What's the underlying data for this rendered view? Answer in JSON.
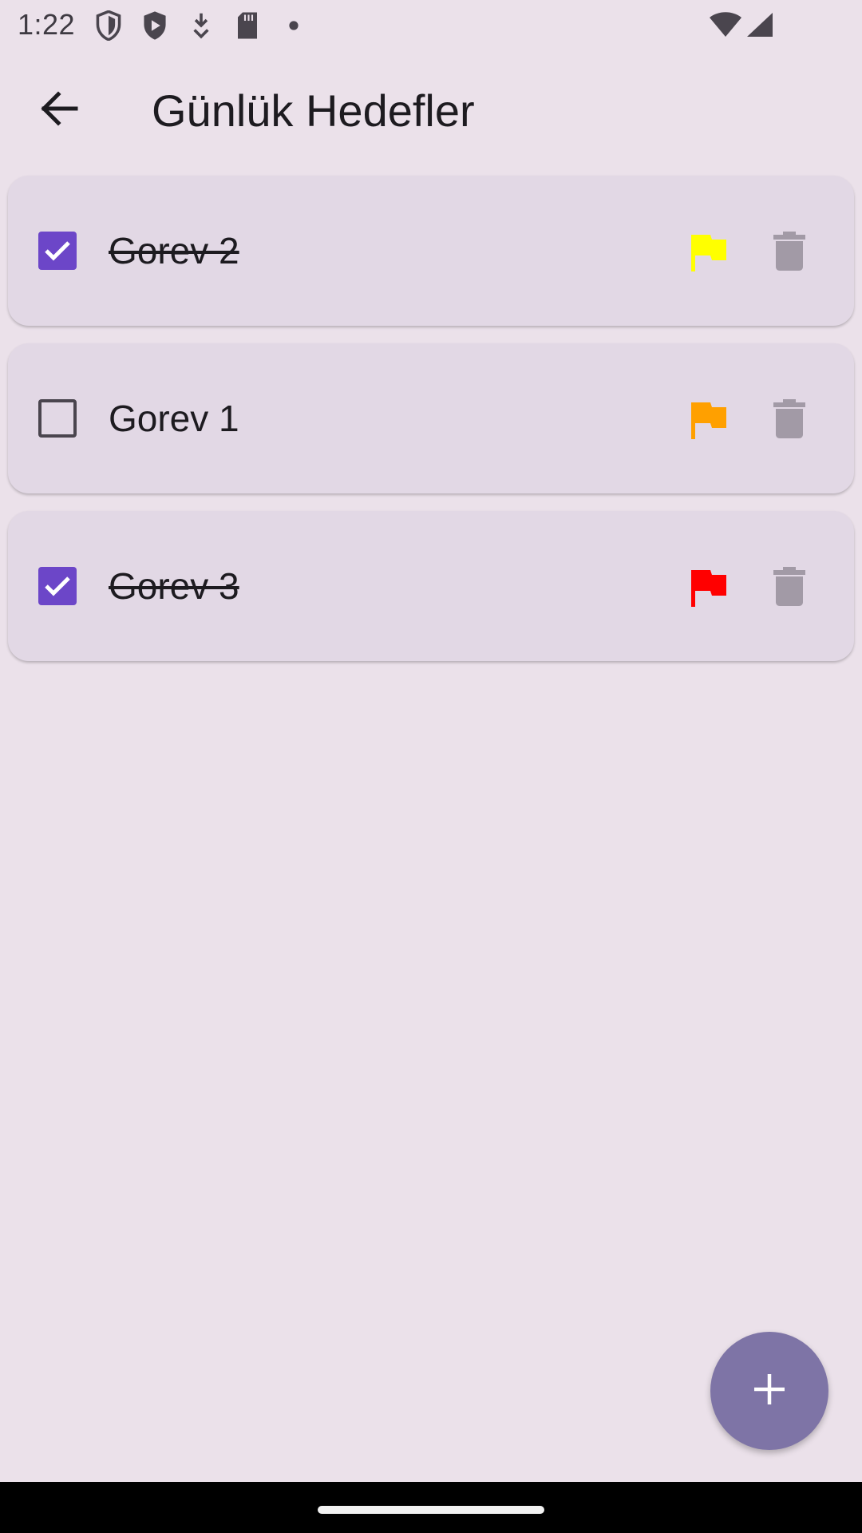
{
  "status_bar": {
    "time": "1:22",
    "icons": [
      "shield-outline-icon",
      "shield-play-icon",
      "download-icon",
      "sd-card-icon",
      "dot-icon"
    ],
    "right_icons": [
      "wifi-icon",
      "signal-icon"
    ]
  },
  "app_bar": {
    "title": "Günlük Hedefler",
    "back_icon": "arrow-back-icon"
  },
  "tasks": [
    {
      "title": "Gorev 2",
      "checked": true,
      "flag_color": "#FFFF00"
    },
    {
      "title": "Gorev 1",
      "checked": false,
      "flag_color": "#FFA000"
    },
    {
      "title": "Gorev 3",
      "checked": true,
      "flag_color": "#FF0000"
    }
  ],
  "fab": {
    "icon": "plus-icon"
  },
  "colors": {
    "background": "#EBE1EA",
    "card": "#E2D8E5",
    "checkbox_checked": "#6C46C8",
    "delete_icon": "#A29AA6",
    "fab": "#7E74A6"
  }
}
